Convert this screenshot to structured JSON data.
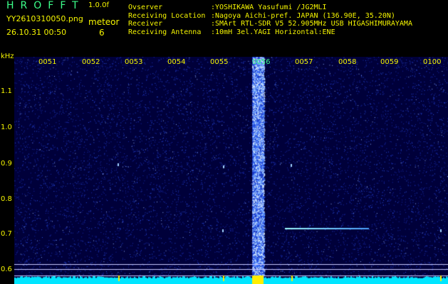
{
  "header": {
    "app_title": "HROFFT",
    "app_version": "1.0.0f",
    "file_name": "YY2610310050.png",
    "timestamp": "26.10.31 00:50",
    "meteor_label": "meteor",
    "meteor_count": "6",
    "info": [
      {
        "key": "Ovserver",
        "value": ":YOSHIKAWA Yasufumi /JG2MLI"
      },
      {
        "key": "Receiving Location",
        "value": ":Nagoya Aichi-pref. JAPAN (136.90E, 35.20N)"
      },
      {
        "key": "Receiver",
        "value": ":SMArt RTL-SDR V5 52.905MHz USB HIGASHIMURAYAMA"
      },
      {
        "key": "Receiving Antenna",
        "value": ":10mH 3el.YAGI Horizontal:ENE"
      }
    ]
  },
  "axis": {
    "unit": "kHz",
    "y_ticks": [
      "1.1",
      "1.0",
      "0.9",
      "0.8",
      "0.7",
      "0.6"
    ],
    "time_labels": [
      "0051",
      "0052",
      "0053",
      "0054",
      "0055",
      "0056",
      "0057",
      "0058",
      "0059",
      "0100"
    ],
    "highlight_label": "0056"
  },
  "colors": {
    "background": "#00003a",
    "label_yellow": "#f5f500",
    "label_green": "#3cff8a",
    "noise_dot": "#3060ff",
    "echo_line": "#a0ffff",
    "baseline": "#00e5ff"
  }
}
